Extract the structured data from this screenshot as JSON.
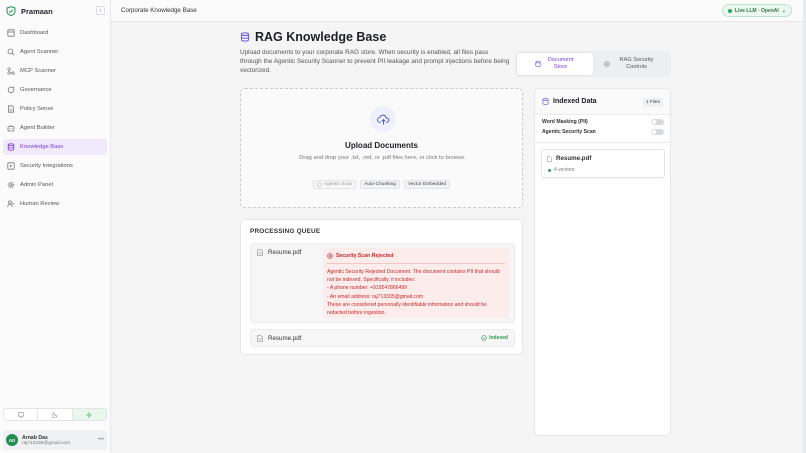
{
  "brand": {
    "name": "Pramaan"
  },
  "sidebar": {
    "items": [
      {
        "label": "Dashboard"
      },
      {
        "label": "Agent Scanner"
      },
      {
        "label": "MCP Scanner"
      },
      {
        "label": "Governance"
      },
      {
        "label": "Policy Sense"
      },
      {
        "label": "Agent Builder"
      },
      {
        "label": "Knowledge Base"
      },
      {
        "label": "Security Integrations"
      },
      {
        "label": "Admin Panel"
      },
      {
        "label": "Human Review"
      }
    ],
    "active_index": 6
  },
  "user": {
    "initials": "AD",
    "name": "Arnab Das",
    "email": "raj713335@gmail.com"
  },
  "header": {
    "breadcrumb": "Corporate Knowledge Base",
    "llm_status": "Live LLM · OpenAI"
  },
  "page": {
    "title": "RAG Knowledge Base",
    "description": "Upload documents to your corporate RAG store. When security is enabled, all files pass through the Agentic Security Scanner to prevent PII leakage and prompt injections before being vectorized."
  },
  "tabs": {
    "document_store": "Document Store",
    "rag_security": "RAG Security Controls"
  },
  "upload": {
    "title": "Upload Documents",
    "subtitle": "Drag and drop your .txt, .md, or .pdf files here, or click to browse.",
    "chips": [
      "Agentic Scan",
      "Auto-Chunking",
      "Vector Embedded"
    ]
  },
  "queue": {
    "title": "PROCESSING QUEUE",
    "items": [
      {
        "file": "Resume.pdf",
        "status": "Security Scan Rejected",
        "message": [
          "Agentic Security Rejected Document: The document contains PII that should not be indexed. Specifically, it includes:",
          "- A phone number: +919547866499",
          "- An email address: raj713335@gmail.com",
          "These are considered personally identifiable information and should be redacted before ingestion."
        ]
      },
      {
        "file": "Resume.pdf",
        "status": "Indexed"
      }
    ]
  },
  "indexed": {
    "title": "Indexed Data",
    "count": "1 Files",
    "toggles": [
      {
        "label": "Word Masking (PII)",
        "on": false
      },
      {
        "label": "Agentic Security Scan",
        "on": false
      }
    ],
    "docs": [
      {
        "name": "Resume.pdf",
        "vectors": "4 vectors"
      }
    ]
  },
  "colors": {
    "accent": "#7a3fd4",
    "success": "#2a9b4e",
    "danger": "#c62828"
  }
}
